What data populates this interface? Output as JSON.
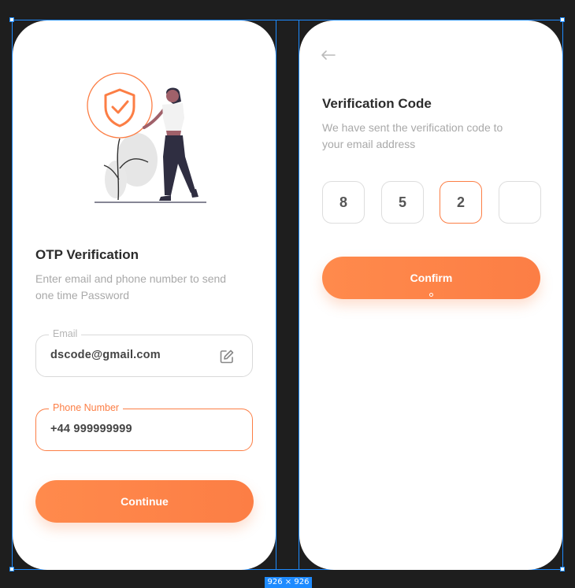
{
  "screen1": {
    "title": "OTP Verification",
    "subtitle": "Enter email and phone number to send one time Password",
    "email_label": "Email",
    "email_value": "dscode@gmail.com",
    "phone_label": "Phone Number",
    "phone_value": "+44 999999999",
    "continue_label": "Continue"
  },
  "screen2": {
    "title": "Verification Code",
    "subtitle": "We have sent the verification code to your email address",
    "otp_digits": [
      "8",
      "5",
      "2",
      ""
    ],
    "confirm_label": "Confirm"
  },
  "frame_size": "926 × 926",
  "colors": {
    "accent": "#fc7e45",
    "selection": "#1e8bff",
    "canvas": "#1e1e1e"
  }
}
